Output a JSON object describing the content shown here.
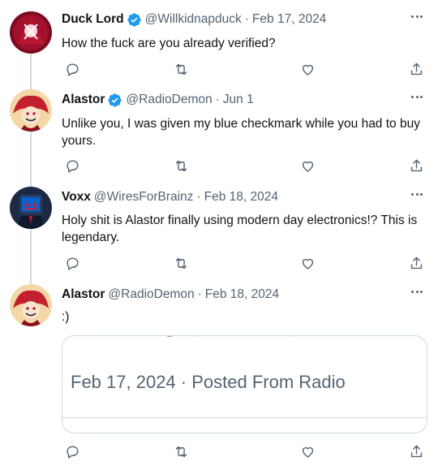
{
  "colors": {
    "verified": "#1d9bf0",
    "secondary": "#536471",
    "thread_line": "#cfd9de"
  },
  "tweets": [
    {
      "name": "Duck Lord",
      "verified": true,
      "handle": "@Willkidnapduck",
      "dot": "·",
      "date": "Feb 17, 2024",
      "text": "How the fuck are you already verified?"
    },
    {
      "name": "Alastor",
      "verified": true,
      "handle": "@RadioDemon",
      "dot": "·",
      "date": "Jun 1",
      "text": "Unlike you, I was given my blue checkmark while you had to buy yours."
    },
    {
      "name": "Voxx",
      "verified": false,
      "handle": "@WiresForBrainz",
      "dot": "·",
      "date": "Feb 18, 2024",
      "text": "Holy shit is Alastor finally using modern day electronics!? This is legendary."
    },
    {
      "name": "Alastor",
      "verified": false,
      "handle": "@RadioDemon",
      "dot": "·",
      "date": "Feb 18, 2024",
      "text": ":)",
      "media": {
        "text": "Feb 17, 2024 · Posted From Radio"
      }
    }
  ],
  "icons": [
    "more-icon",
    "reply-icon",
    "retweet-icon",
    "like-icon",
    "share-icon",
    "verified-badge-icon"
  ]
}
